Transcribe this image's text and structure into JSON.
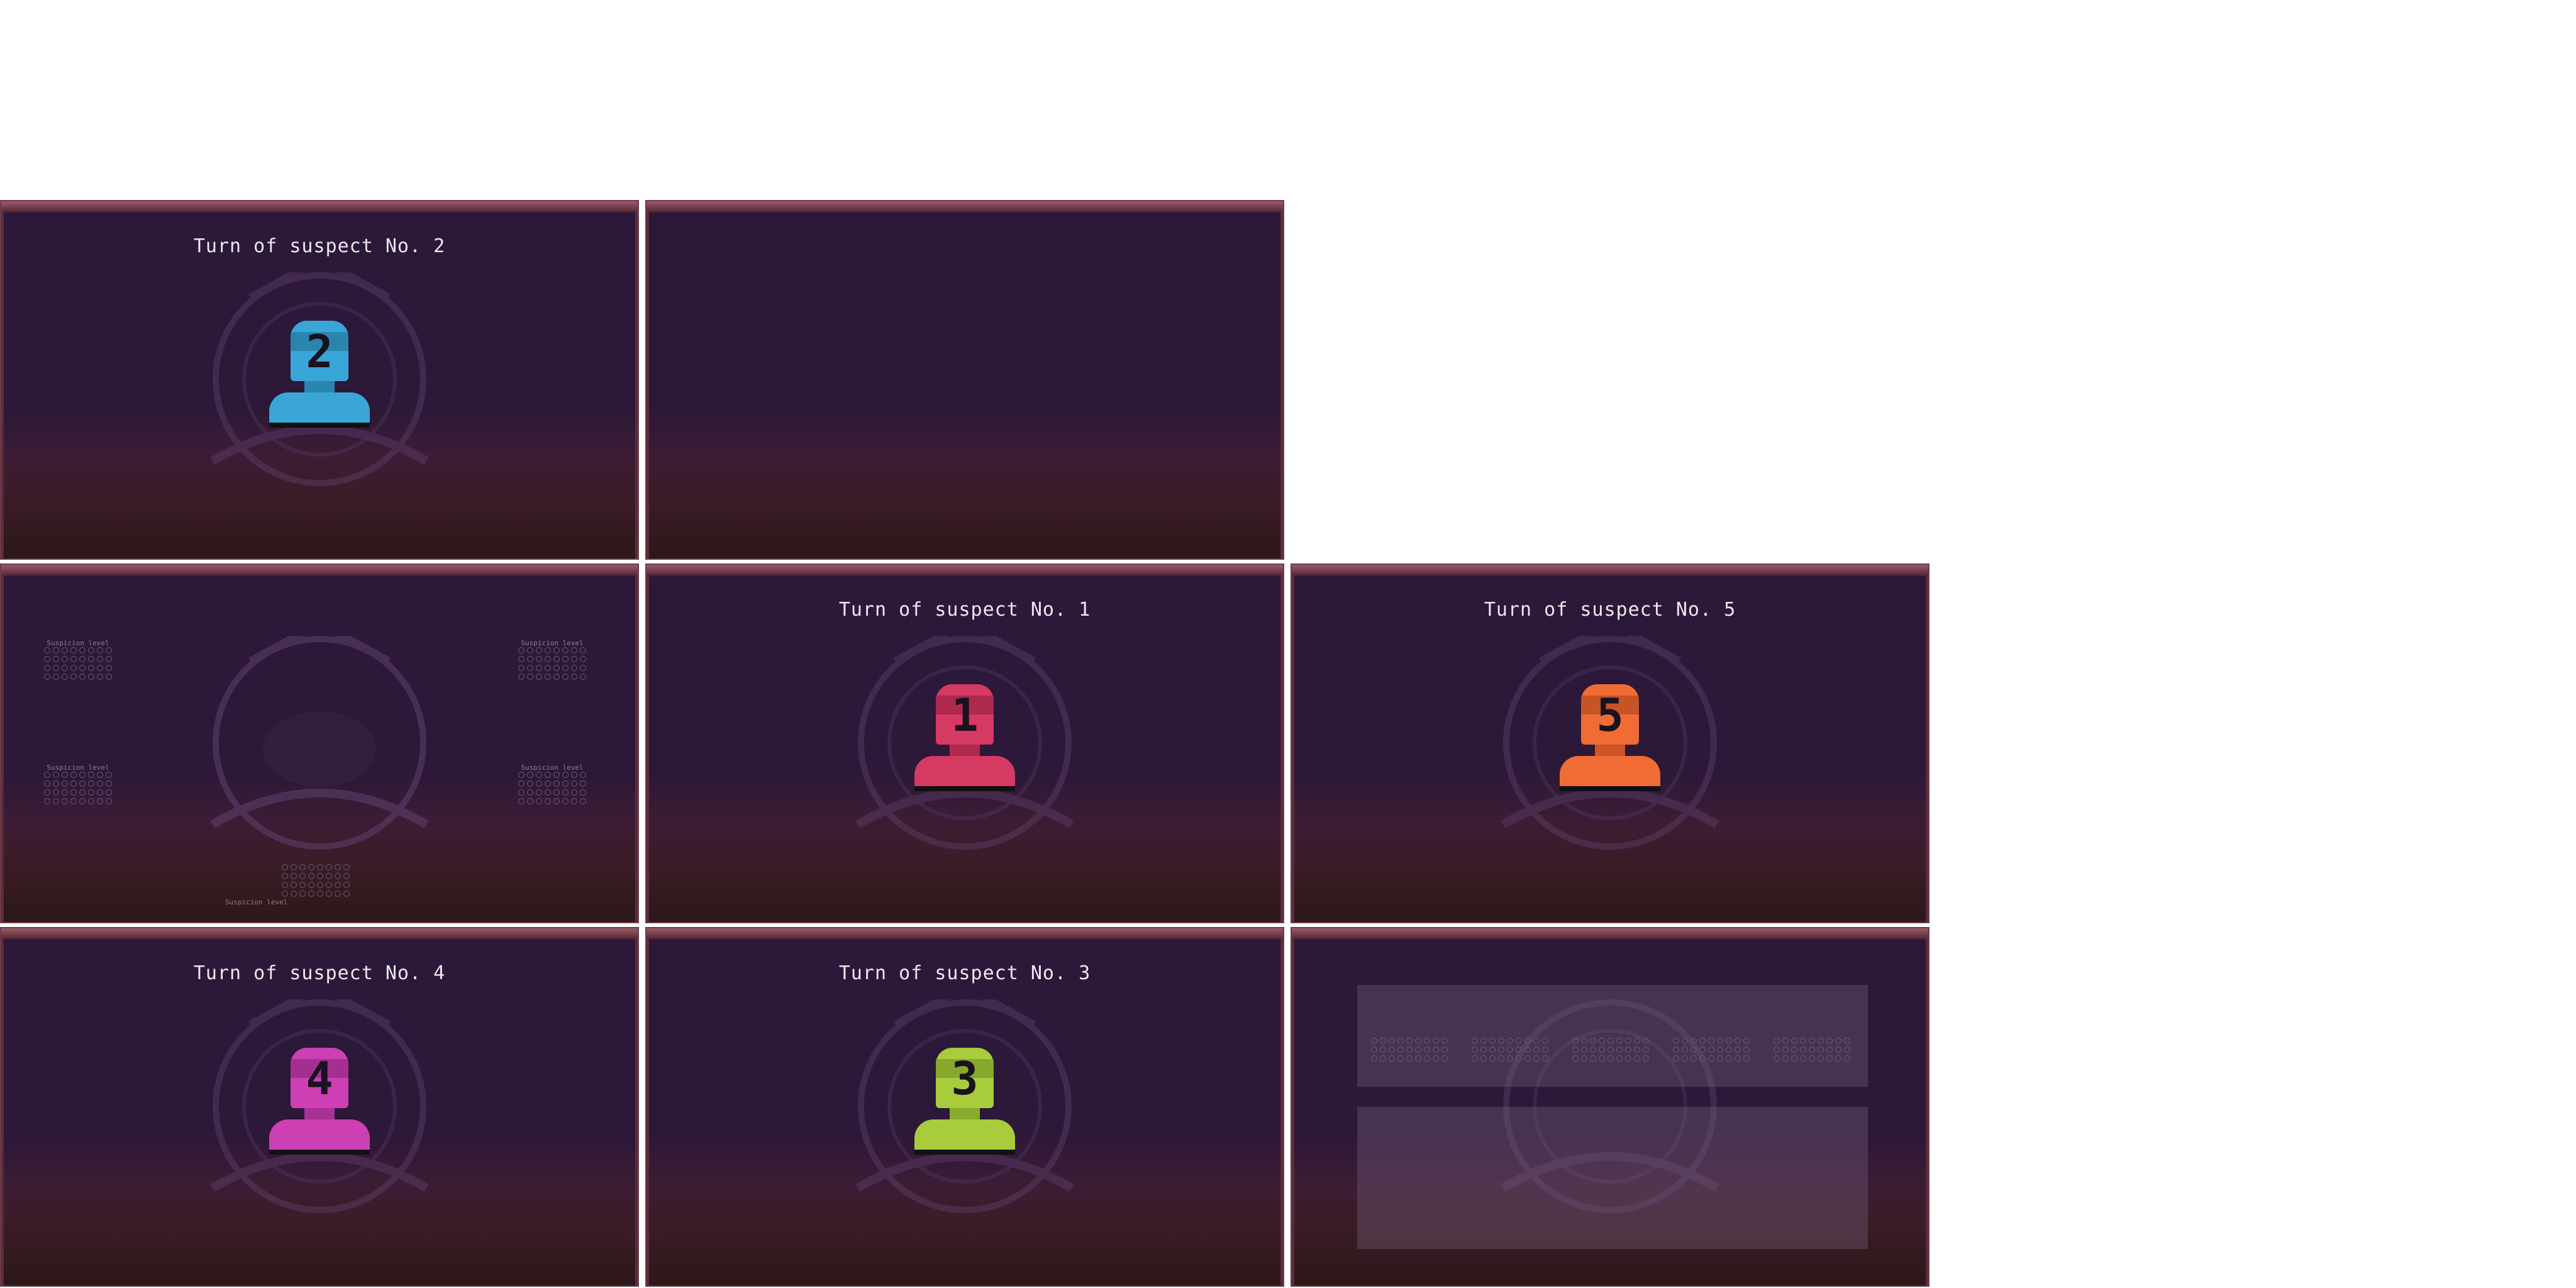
{
  "colors": {
    "suspect_1": "#d43a62",
    "suspect_2": "#3aa6d8",
    "suspect_3": "#a8cc3c",
    "suspect_4": "#cc40b4",
    "suspect_5": "#f06c34"
  },
  "panels": {
    "p1": {
      "title": "Turn of suspect No. 2",
      "suspect_number": "2"
    },
    "p4": {
      "title": "Turn of suspect No. 1",
      "suspect_number": "1"
    },
    "p5": {
      "title": "Turn of suspect No. 5",
      "suspect_number": "5"
    },
    "p6": {
      "title": "Turn of suspect No. 4",
      "suspect_number": "4"
    },
    "p7": {
      "title": "Turn of suspect No. 3",
      "suspect_number": "3"
    }
  },
  "suspicion": {
    "label": "Suspicion level"
  },
  "icons": {
    "emblem": "eye-emblem-icon",
    "suspect": "suspect-figure-icon"
  }
}
